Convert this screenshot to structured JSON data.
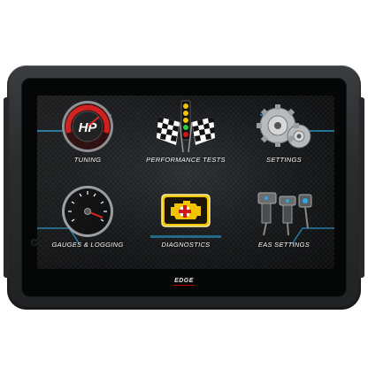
{
  "device": {
    "brand": "EDGE"
  },
  "menu": [
    {
      "label": "TUNING",
      "icon": "hp-gauge-icon"
    },
    {
      "label": "PERFORMANCE TESTS",
      "icon": "drag-tree-flags-icon"
    },
    {
      "label": "SETTINGS",
      "icon": "gears-icon"
    },
    {
      "label": "GAUGES & LOGGING",
      "icon": "gauge-icon"
    },
    {
      "label": "DIAGNOSTICS",
      "icon": "check-engine-icon"
    },
    {
      "label": "EAS SETTINGS",
      "icon": "eas-connectors-icon"
    }
  ],
  "colors": {
    "accent_blue": "#2ea8e0",
    "warning_yellow": "#f2c300",
    "alert_red": "#d01818"
  }
}
